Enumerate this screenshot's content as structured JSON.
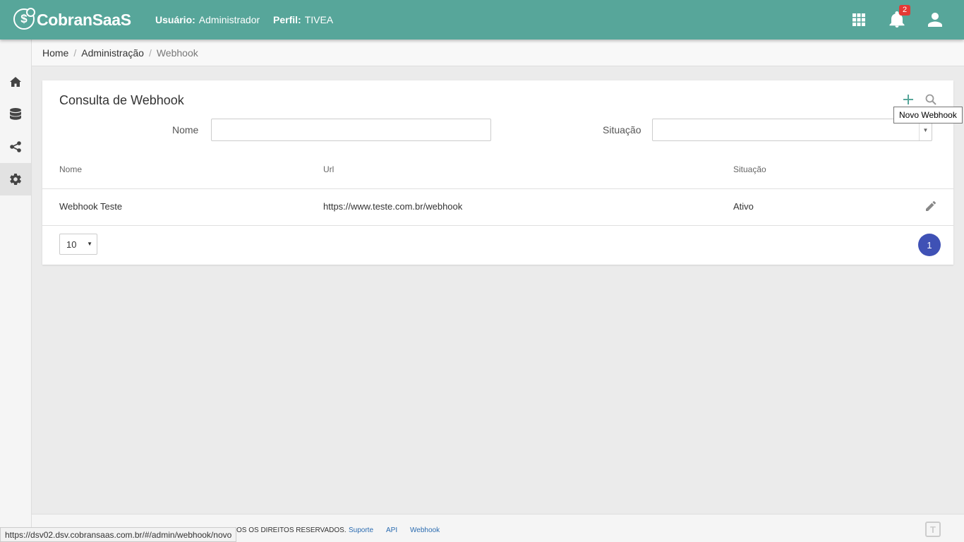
{
  "header": {
    "logo_text": "CobranSaaS",
    "logo_mark": "$",
    "user_label": "Usuário:",
    "user_value": "Administrador",
    "profile_label": "Perfil:",
    "profile_value": "TIVEA",
    "notification_count": "2",
    "icons": [
      "apps-grid-icon",
      "bell-icon",
      "account-icon"
    ],
    "bg_color": "#57a69a"
  },
  "sidebar": {
    "items": [
      {
        "name": "home",
        "icon": "home-icon"
      },
      {
        "name": "database",
        "icon": "database-icon"
      },
      {
        "name": "share",
        "icon": "share-icon"
      },
      {
        "name": "settings",
        "icon": "gear-icon",
        "active": true
      }
    ]
  },
  "breadcrumb": {
    "items": [
      "Home",
      "Administração",
      "Webhook"
    ],
    "separator": "/"
  },
  "card": {
    "title": "Consulta de Webhook",
    "filters": {
      "nome_label": "Nome",
      "nome_value": "",
      "situacao_label": "Situação",
      "situacao_value": ""
    },
    "table": {
      "columns": [
        "Nome",
        "Url",
        "Situação"
      ],
      "rows": [
        {
          "nome": "Webhook Teste",
          "url": "https://www.teste.com.br/webhook",
          "situacao": "Ativo"
        }
      ]
    },
    "page_size": "10",
    "current_page": "1",
    "page_color": "#3f51b5"
  },
  "tooltip": {
    "text": "Novo Webhook"
  },
  "footer": {
    "copyright_visible": "OS OS DIREITOS RESERVADOS.",
    "links": [
      "Suporte",
      "API",
      "Webhook"
    ]
  },
  "statusbar": {
    "url": "https://dsv02.dsv.cobransaas.com.br/#/admin/webhook/novo"
  }
}
